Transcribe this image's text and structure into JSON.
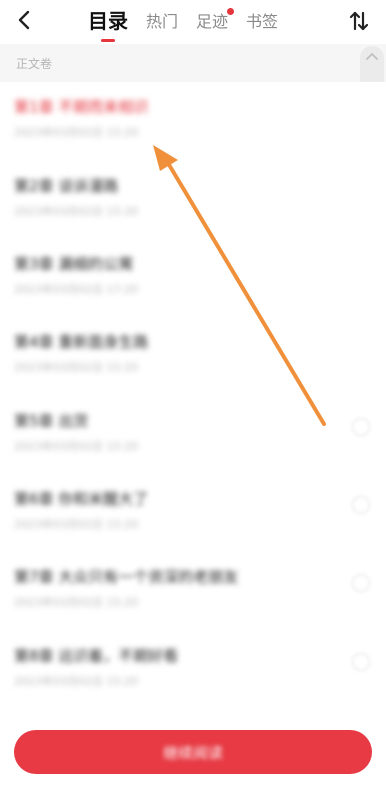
{
  "header": {
    "back_icon": "chevron-left-icon",
    "tabs": [
      {
        "label": "目录",
        "active": true
      },
      {
        "label": "热门",
        "active": false
      },
      {
        "label": "足迹",
        "active": false,
        "badge_dot": true
      },
      {
        "label": "书签",
        "active": false
      }
    ],
    "sort_icon": "sort-arrows-icon"
  },
  "volume": {
    "label": "正文卷"
  },
  "chapters": [
    {
      "title": "第1章 不期而来相识",
      "date": "2023年03月02日 15:20",
      "current": true
    },
    {
      "title": "第2章 谈诉漫路",
      "date": "2023年03月02日 15:20"
    },
    {
      "title": "第3章 漏细的公寓",
      "date": "2023年03月02日 17:20"
    },
    {
      "title": "第4章 重新面身生路",
      "date": "2023年03月02日 15:20"
    },
    {
      "title": "第5章 出货",
      "date": "2023年03月02日 15:20"
    },
    {
      "title": "第6章 你和米醒大了",
      "date": "2023年03月02日 15:20"
    },
    {
      "title": "第7章 大众只有一个资深的老朋友",
      "date": "2023年03月02日 15:20"
    },
    {
      "title": "第8章 远识着，不期好看",
      "date": "2023年03月02日 15:20"
    }
  ],
  "continue_button": {
    "label": "继续阅读"
  },
  "colors": {
    "accent": "#e5353d",
    "arrow": "#f0903a"
  }
}
